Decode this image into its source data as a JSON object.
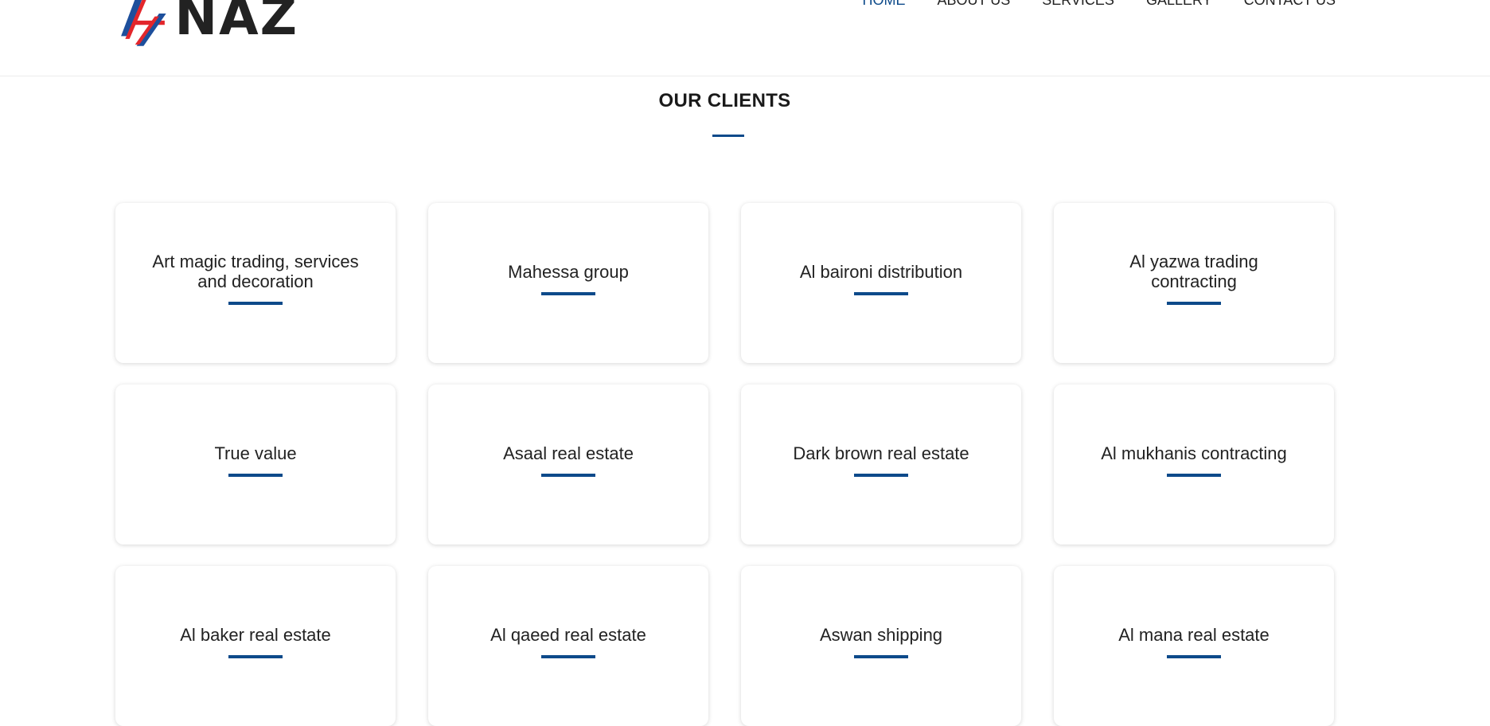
{
  "header": {
    "logo_text": "NAZ",
    "nav": [
      {
        "label": "HOME",
        "active": true
      },
      {
        "label": "ABOUT US",
        "active": false
      },
      {
        "label": "SERVICES",
        "active": false
      },
      {
        "label": "GALLERY",
        "active": false
      },
      {
        "label": "CONTACT US",
        "active": false
      }
    ]
  },
  "section": {
    "title": "OUR CLIENTS"
  },
  "clients": [
    {
      "name": "Art magic trading, services and decoration"
    },
    {
      "name": "Mahessa group"
    },
    {
      "name": "Al baironi distribution"
    },
    {
      "name": "Al yazwa trading contracting"
    },
    {
      "name": "True value"
    },
    {
      "name": "Asaal real estate"
    },
    {
      "name": "Dark brown real estate"
    },
    {
      "name": "Al mukhanis contracting"
    },
    {
      "name": "Al baker real estate"
    },
    {
      "name": "Al qaeed real estate"
    },
    {
      "name": "Aswan shipping"
    },
    {
      "name": "Al mana real estate"
    }
  ],
  "colors": {
    "accent": "#0d4a8a",
    "logo_red": "#e3262b",
    "logo_blue": "#1d4f9c",
    "text": "#222222"
  }
}
